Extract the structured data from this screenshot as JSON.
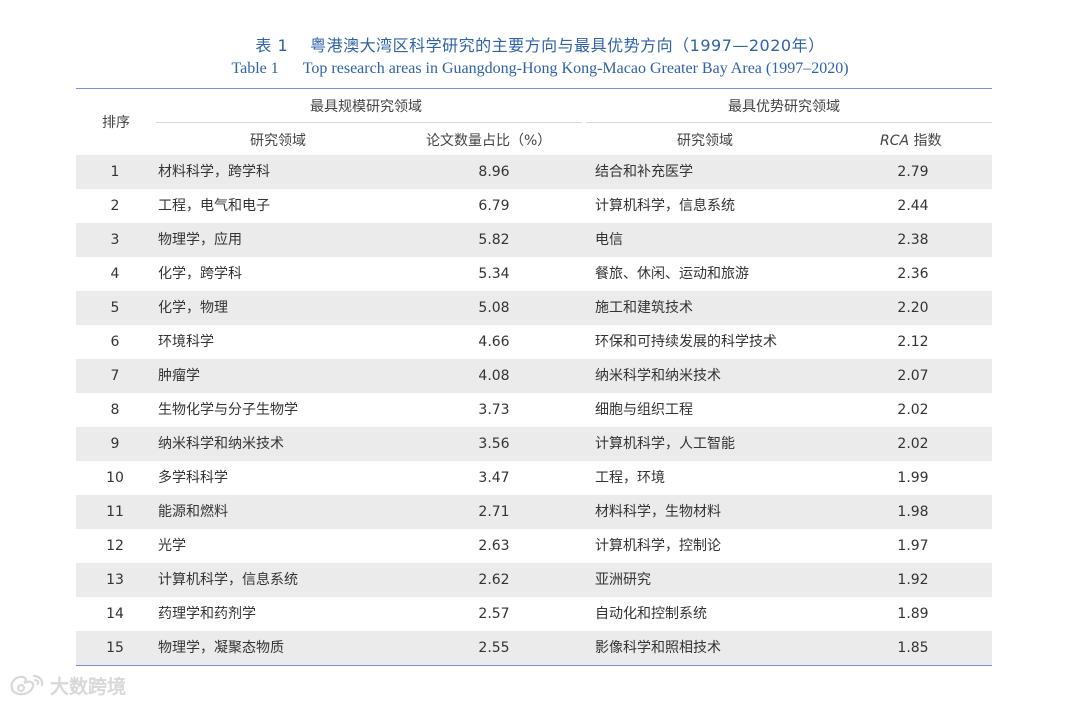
{
  "title_zh": {
    "number": "表 1",
    "text": "粤港澳大湾区科学研究的主要方向与最具优势方向（1997—2020年）"
  },
  "title_en": {
    "number": "Table 1",
    "text": "Top research areas in Guangdong-Hong Kong-Macao Greater Bay Area  (1997–2020)"
  },
  "header": {
    "rank": "排序",
    "group_scale": "最具规模研究领域",
    "group_advantage": "最具优势研究领域",
    "col_area1": "研究领域",
    "col_pct": "论文数量占比（%）",
    "col_area2": "研究领域",
    "col_rca_italic": "RCA",
    "col_rca_rest": " 指数"
  },
  "rows": [
    {
      "rank": "1",
      "area1": "材料科学，跨学科",
      "pct": "8.96",
      "area2": "结合和补充医学",
      "rca": "2.79"
    },
    {
      "rank": "2",
      "area1": "工程，电气和电子",
      "pct": "6.79",
      "area2": "计算机科学，信息系统",
      "rca": "2.44"
    },
    {
      "rank": "3",
      "area1": "物理学，应用",
      "pct": "5.82",
      "area2": "电信",
      "rca": "2.38"
    },
    {
      "rank": "4",
      "area1": "化学，跨学科",
      "pct": "5.34",
      "area2": "餐旅、休闲、运动和旅游",
      "rca": "2.36"
    },
    {
      "rank": "5",
      "area1": "化学，物理",
      "pct": "5.08",
      "area2": "施工和建筑技术",
      "rca": "2.20"
    },
    {
      "rank": "6",
      "area1": "环境科学",
      "pct": "4.66",
      "area2": "环保和可持续发展的科学技术",
      "rca": "2.12"
    },
    {
      "rank": "7",
      "area1": "肿瘤学",
      "pct": "4.08",
      "area2": "纳米科学和纳米技术",
      "rca": "2.07"
    },
    {
      "rank": "8",
      "area1": "生物化学与分子生物学",
      "pct": "3.73",
      "area2": "细胞与组织工程",
      "rca": "2.02"
    },
    {
      "rank": "9",
      "area1": "纳米科学和纳米技术",
      "pct": "3.56",
      "area2": "计算机科学，人工智能",
      "rca": "2.02"
    },
    {
      "rank": "10",
      "area1": "多学科科学",
      "pct": "3.47",
      "area2": "工程，环境",
      "rca": "1.99"
    },
    {
      "rank": "11",
      "area1": "能源和燃料",
      "pct": "2.71",
      "area2": "材料科学，生物材料",
      "rca": "1.98"
    },
    {
      "rank": "12",
      "area1": "光学",
      "pct": "2.63",
      "area2": "计算机科学，控制论",
      "rca": "1.97"
    },
    {
      "rank": "13",
      "area1": "计算机科学，信息系统",
      "pct": "2.62",
      "area2": "亚洲研究",
      "rca": "1.92"
    },
    {
      "rank": "14",
      "area1": "药理学和药剂学",
      "pct": "2.57",
      "area2": "自动化和控制系统",
      "rca": "1.89"
    },
    {
      "rank": "15",
      "area1": "物理学，凝聚态物质",
      "pct": "2.55",
      "area2": "影像科学和照相技术",
      "rca": "1.85"
    }
  ],
  "watermark": {
    "text": "大数跨境",
    "icon": "weibo-logo-icon"
  },
  "colors": {
    "title": "#2f62a7",
    "rule": "#6d9ac9",
    "shade": "#ebebeb",
    "watermark": "#d8d8d8"
  }
}
